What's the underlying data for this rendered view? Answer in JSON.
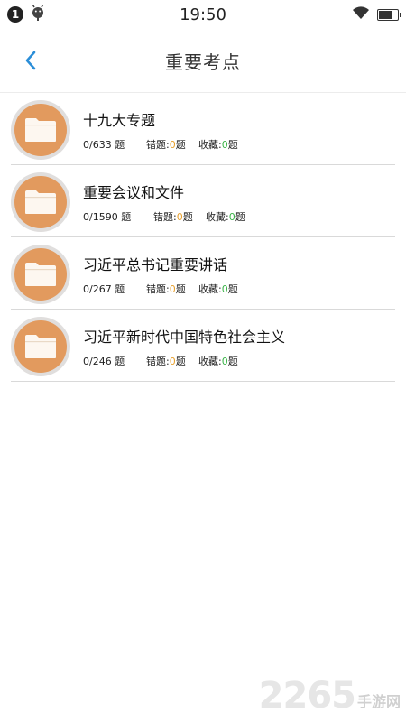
{
  "status_bar": {
    "notification_count": "1",
    "time": "19:50"
  },
  "nav": {
    "title": "重要考点"
  },
  "items": [
    {
      "title": "十九大专题",
      "progress": "0/633 题",
      "wrong_label": "错题:",
      "wrong_count": "0",
      "wrong_unit": "题",
      "fav_label": "收藏:",
      "fav_count": "0",
      "fav_unit": "题"
    },
    {
      "title": "重要会议和文件",
      "progress": "0/1590 题",
      "wrong_label": "错题:",
      "wrong_count": "0",
      "wrong_unit": "题",
      "fav_label": "收藏:",
      "fav_count": "0",
      "fav_unit": "题"
    },
    {
      "title": "习近平总书记重要讲话",
      "progress": "0/267 题",
      "wrong_label": "错题:",
      "wrong_count": "0",
      "wrong_unit": "题",
      "fav_label": "收藏:",
      "fav_count": "0",
      "fav_unit": "题"
    },
    {
      "title": "习近平新时代中国特色社会主义",
      "progress": "0/246 题",
      "wrong_label": "错题:",
      "wrong_count": "0",
      "wrong_unit": "题",
      "fav_label": "收藏:",
      "fav_count": "0",
      "fav_unit": "题"
    }
  ],
  "watermark": {
    "number": "2265",
    "text": "手游网"
  },
  "colors": {
    "accent": "#2b8ed8",
    "folder_circle": "#e29a5e",
    "wrong_count": "#e8a02d",
    "fav_count": "#3cb449"
  }
}
